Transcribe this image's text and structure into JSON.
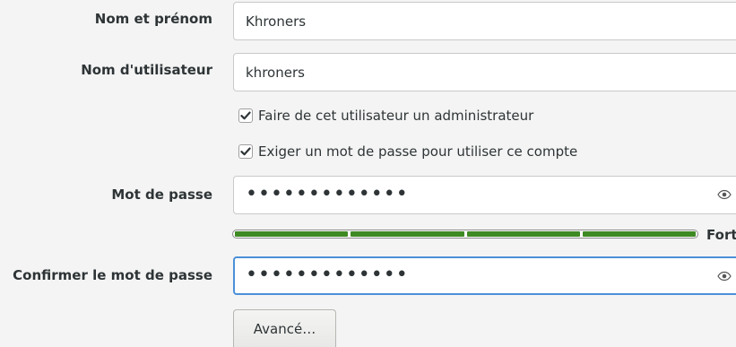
{
  "form": {
    "fullname_label": "Nom et prénom",
    "fullname_value": "Khroners",
    "username_label": "Nom d'utilisateur",
    "username_value": "khroners",
    "admin_checkbox_label": "Faire de cet utilisateur un administrateur",
    "admin_checked": true,
    "require_password_label": "Exiger un mot de passe pour utiliser ce compte",
    "require_password_checked": true,
    "password_label": "Mot de passe",
    "password_value": "•••••••••••••",
    "strength_label": "Fort",
    "strength_level": 1.0,
    "confirm_label": "Confirmer le mot de passe",
    "confirm_value": "•••••••••••••",
    "advanced_button": "Avancé…"
  },
  "icons": {
    "reveal_password": "eye-icon",
    "checkmark": "check-icon"
  },
  "colors": {
    "strength_fill": "#3e8a23",
    "focus_border": "#4a90d9"
  }
}
